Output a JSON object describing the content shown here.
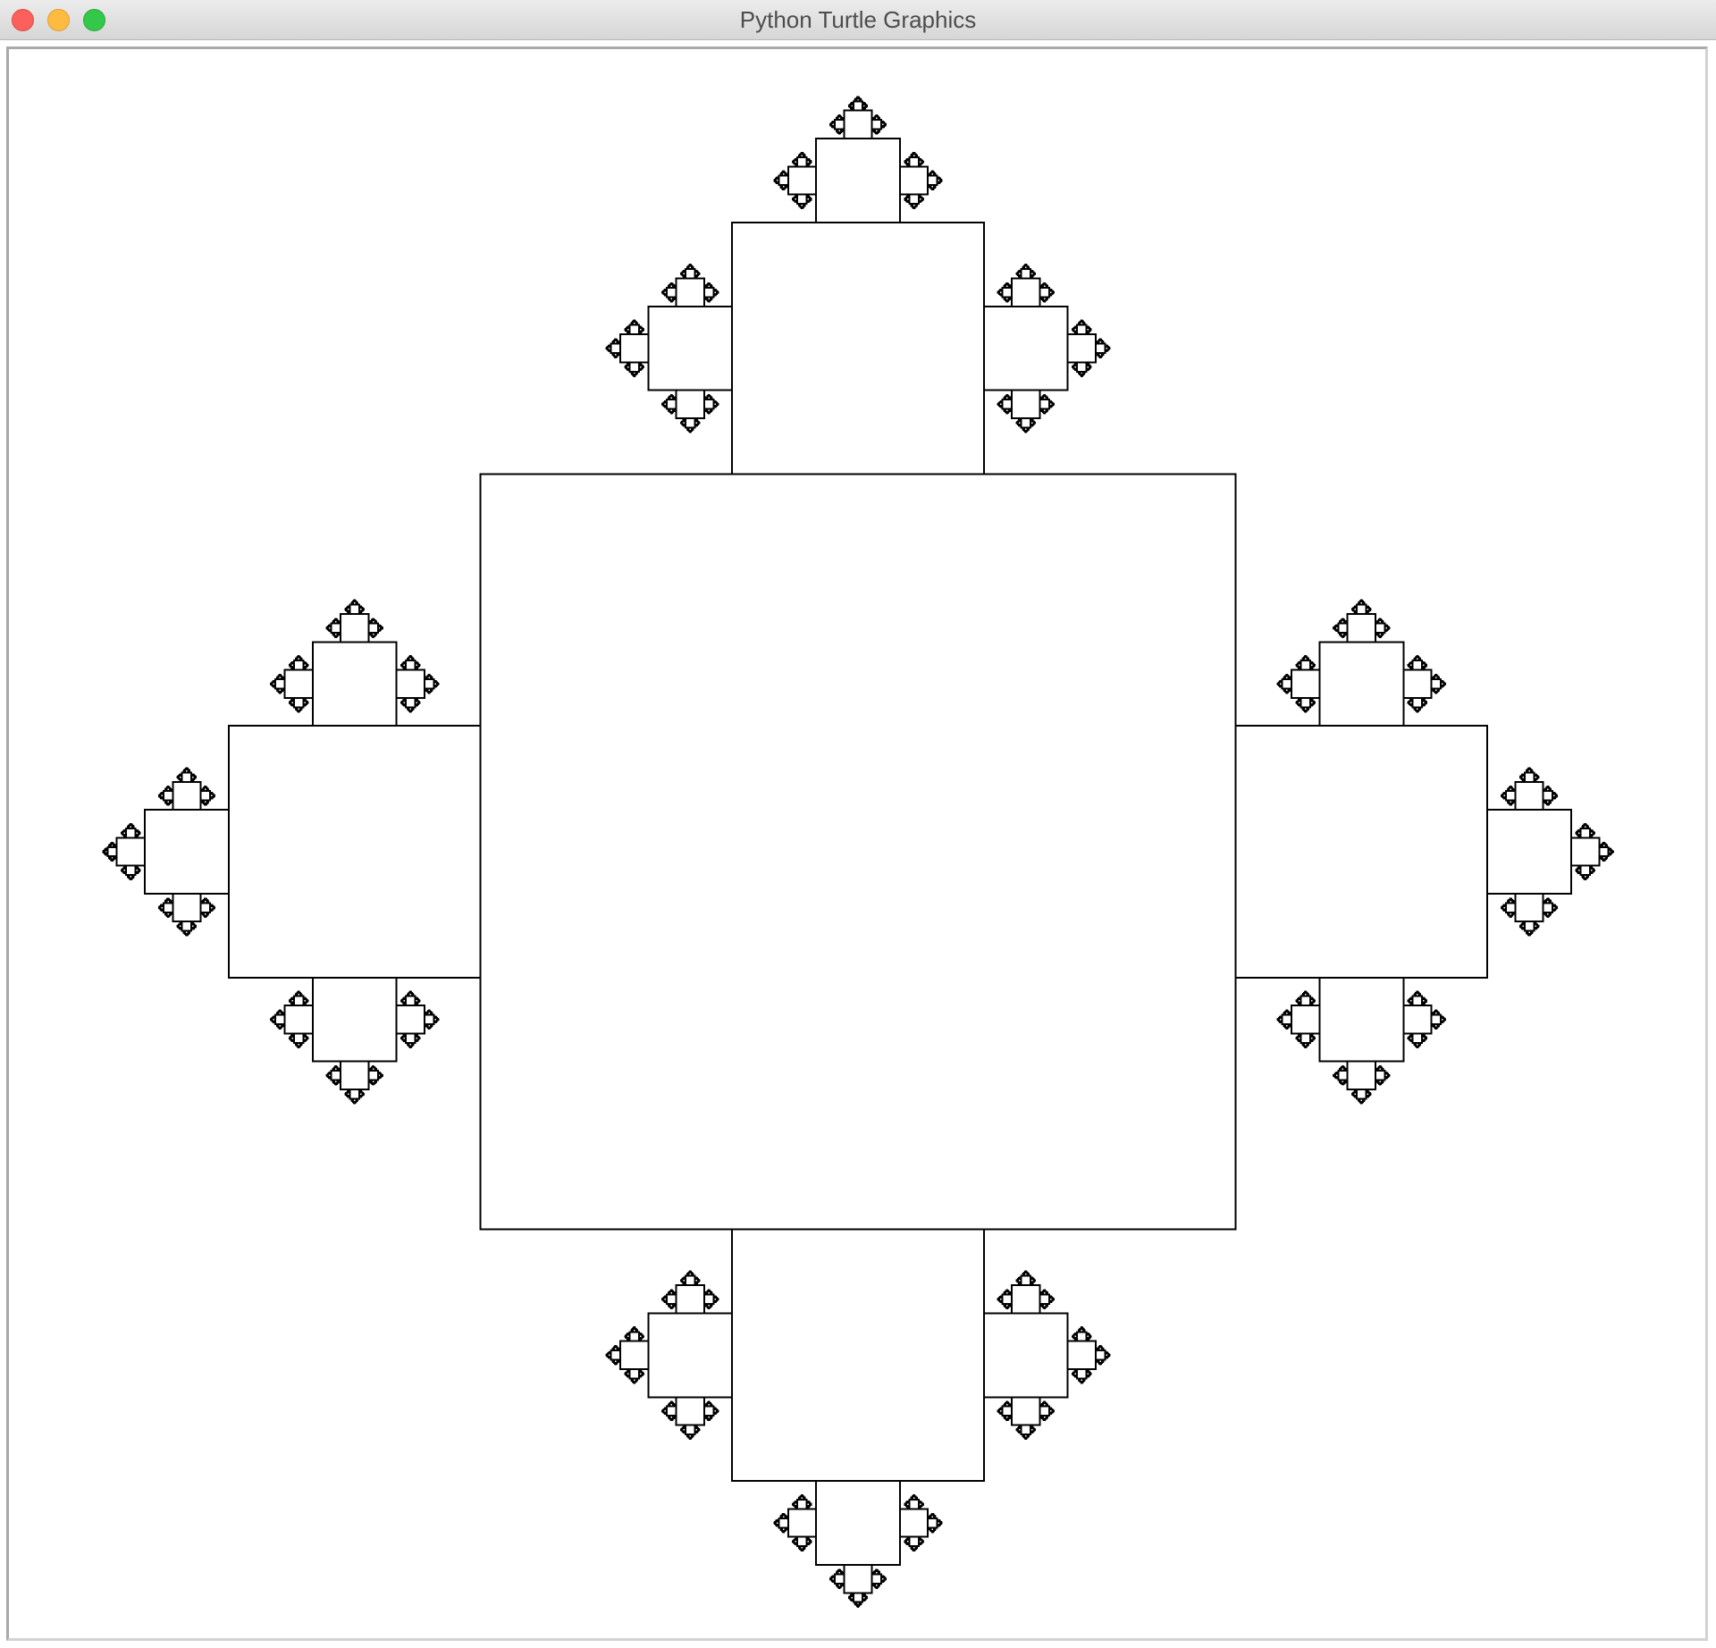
{
  "window": {
    "title": "Python Turtle Graphics"
  },
  "controls": [
    "close",
    "minimize",
    "zoom"
  ],
  "colors": {
    "close": "#fc605c",
    "minimize": "#fdbc40",
    "zoom": "#34c84a",
    "stroke": "#000000",
    "canvas_background": "#ffffff"
  },
  "drawing": {
    "shape": "square fractal",
    "recursion_depth": 8,
    "scale_ratio": 0.3333
  }
}
